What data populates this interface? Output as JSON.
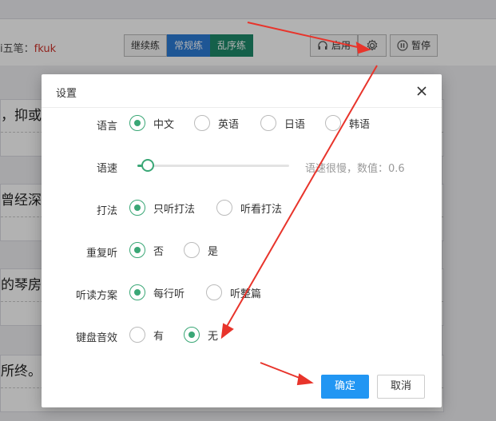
{
  "toolbar": {
    "label_prefix": "i五笔：",
    "label_value": "fkuk",
    "modes": [
      "继续练",
      "常规练",
      "乱序练"
    ],
    "listen_label": "启用",
    "pause_label": "暂停"
  },
  "background_lines": [
    "，抑或",
    "曾经深",
    "的琴房",
    "所终。"
  ],
  "dialog": {
    "title": "设置",
    "language": {
      "label": "语言",
      "options": [
        "中文",
        "英语",
        "日语",
        "韩语"
      ],
      "selected": "中文"
    },
    "speed": {
      "label": "语速",
      "info": "语速很慢，数值：0.6",
      "value": 0.6,
      "range": [
        0.5,
        2.0
      ]
    },
    "style": {
      "label": "打法",
      "options": [
        "只听打法",
        "听看打法"
      ],
      "selected": "只听打法"
    },
    "repeat": {
      "label": "重复听",
      "options": [
        "否",
        "是"
      ],
      "selected": "否"
    },
    "scheme": {
      "label": "听读方案",
      "options": [
        "每行听",
        "听整篇"
      ],
      "selected": "每行听"
    },
    "keysound": {
      "label": "键盘音效",
      "options": [
        "有",
        "无"
      ],
      "selected": "无"
    },
    "ok_label": "确定",
    "cancel_label": "取消"
  },
  "colors": {
    "accent": "#3aa776",
    "primary": "#2196f3",
    "arrow": "#e8342b"
  }
}
